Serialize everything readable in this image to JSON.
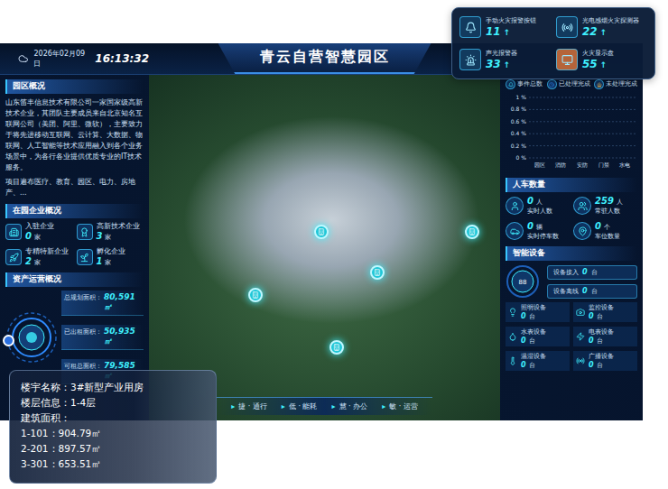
{
  "header": {
    "date": "2026年02月09日",
    "time": "16:13:32",
    "title": "青云自营智慧园区"
  },
  "overview": {
    "title": "园区概况",
    "paragraphs": [
      "山东笛丰信息技术有限公司一家国家级高新技术企业，其团队主要成员来自北京知名互联网公司（美团、阿里、微软），主要致力于将先进移动互联网、云计算、大数据、物联网、人工智能等技术应用融入到各个业务场景中，为各行各业提供优质专业的IT技术服务。",
      "项目遍布医疗、教育、园区、电力、房地产、..."
    ]
  },
  "enterprises": {
    "title": "在园企业概况",
    "items": [
      {
        "label": "入驻企业",
        "value": "0",
        "unit": "家"
      },
      {
        "label": "高新技术企业",
        "value": "3",
        "unit": "家"
      },
      {
        "label": "专精特新企业",
        "value": "2",
        "unit": "家"
      },
      {
        "label": "孵化企业",
        "value": "1",
        "unit": "家"
      }
    ]
  },
  "assets": {
    "title": "资产运营概况",
    "items": [
      {
        "label": "总规划面积：",
        "value": "80,591㎡"
      },
      {
        "label": "已出租面积：",
        "value": "50,935㎡"
      },
      {
        "label": "可租总面积：",
        "value": "79,585㎡"
      }
    ]
  },
  "events": {
    "legend": [
      "事件总数",
      "已处理完成",
      "未处理完成"
    ],
    "y_ticks": [
      "1 %",
      "0.8 %",
      "0.6 %",
      "0.4 %",
      "0.2 %",
      "0 %"
    ],
    "categories": [
      "园区",
      "消防",
      "安防",
      "门禁",
      "水电"
    ],
    "series": [
      {
        "name": "事件总数",
        "values": [
          0,
          0,
          0,
          0,
          0
        ]
      },
      {
        "name": "已处理完成",
        "values": [
          0,
          0,
          0,
          0,
          0
        ]
      },
      {
        "name": "未处理完成",
        "values": [
          0,
          0,
          0,
          0,
          0
        ]
      }
    ]
  },
  "people_cars": {
    "title": "人车数量",
    "items": [
      {
        "value": "0",
        "unit": "人",
        "label": "实时人数"
      },
      {
        "value": "259",
        "unit": "人",
        "label": "常驻人数"
      },
      {
        "value": "0",
        "unit": "辆",
        "label": "实时停车数"
      },
      {
        "value": "0",
        "unit": "个",
        "label": "车位数量"
      }
    ]
  },
  "devices": {
    "title": "智能设备",
    "gauge": "88",
    "summary": [
      {
        "label": "设备接入",
        "value": "0",
        "unit": "台"
      },
      {
        "label": "设备离线",
        "value": "0",
        "unit": "台"
      }
    ],
    "items": [
      {
        "label": "照明设备",
        "value": "0",
        "unit": "台"
      },
      {
        "label": "监控设备",
        "value": "0",
        "unit": "台"
      },
      {
        "label": "水表设备",
        "value": "0",
        "unit": "台"
      },
      {
        "label": "电表设备",
        "value": "0",
        "unit": "台"
      },
      {
        "label": "温湿设备",
        "value": "0",
        "unit": "台"
      },
      {
        "label": "广播设备",
        "value": "0",
        "unit": "台"
      }
    ]
  },
  "nav": [
    {
      "arrow": "▸",
      "label": "捷 · 通行"
    },
    {
      "arrow": "▸",
      "label": "低 · 能耗"
    },
    {
      "arrow": "▸",
      "label": "慧 · 办公"
    },
    {
      "arrow": "▸",
      "label": "敏 · 运营"
    }
  ],
  "fire_alarms": [
    {
      "label": "手动火灾报警按钮",
      "value": "11",
      "trend": "↑",
      "color": "#123a5e"
    },
    {
      "label": "光电感烟火灾探测器",
      "value": "22",
      "trend": "↑",
      "color": "#123a5e"
    },
    {
      "label": "声光报警器",
      "value": "33",
      "trend": "↑",
      "color": "#123a5e"
    },
    {
      "label": "火灾显示盘",
      "value": "55",
      "trend": "↑",
      "color": "#b5643a"
    }
  ],
  "building": {
    "lines": [
      "楼宇名称：3#新型产业用房",
      "楼层信息：1-4层",
      "建筑面积：",
      "1-101：904.79㎡",
      "2-201：897.57㎡",
      "3-301：653.51㎡"
    ]
  }
}
